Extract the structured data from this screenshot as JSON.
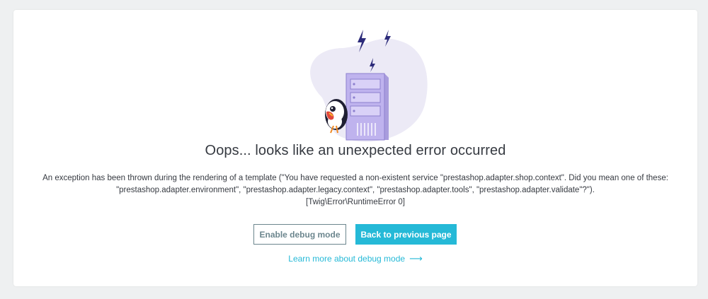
{
  "error": {
    "title": "Oops... looks like an unexpected error occurred",
    "message_line1": "An exception has been thrown during the rendering of a template (\"You have requested a non-existent service \"prestashop.adapter.shop.context\". Did you mean one of these:",
    "message_line2": "\"prestashop.adapter.environment\", \"prestashop.adapter.legacy.context\", \"prestashop.adapter.tools\", \"prestashop.adapter.validate\"?\").",
    "message_line3": "[Twig\\Error\\RuntimeError 0]"
  },
  "actions": {
    "enable_debug_label": "Enable debug mode",
    "back_label": "Back to previous page",
    "learn_more_label": "Learn more about debug mode",
    "learn_more_arrow": "⟶"
  },
  "icons": {
    "illustration": "server-with-lightning-and-puffin-illustration",
    "arrow": "arrow-right-icon"
  },
  "colors": {
    "accent": "#25b9d7",
    "secondary_border": "#6c868e",
    "text": "#363a41",
    "server": "#b9ade6",
    "lightning": "#2c2b7a"
  }
}
